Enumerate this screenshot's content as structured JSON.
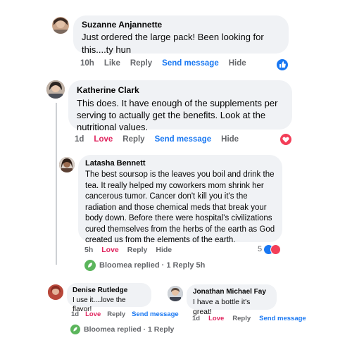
{
  "comments": [
    {
      "name": "Suzanne Anjannette",
      "text": "Just ordered the large pack! Been looking for this....ty hun",
      "time": "10h",
      "reaction": "Like",
      "reply": "Reply",
      "send": "Send message",
      "hide": "Hide"
    },
    {
      "name": "Katherine Clark",
      "text": "This does. It have enough of the supplements per serving to actually get the benefits. Look at the nutritional values.",
      "time": "1d",
      "reaction": "Love",
      "reply": "Reply",
      "send": "Send message",
      "hide": "Hide"
    },
    {
      "name": "Latasha Bennett",
      "text": "The best soursop is the leaves you boil and drink the tea. It really helped my coworkers mom shrink her cancerous tumor. Cancer don't kill you it's the radiation and those chemical meds that break your body down. Before there were hospital's civilizations cured themselves from the herbs of the earth as God created us from the elements of the earth.",
      "time": "5h",
      "reaction": "Love",
      "reply": "Reply",
      "hide": "Hide",
      "reaction_count": "5",
      "replies_text": "Bloomea replied · 1 Reply 5h"
    },
    {
      "name": "Denise Rutledge",
      "text": "I use it....love the flavor!",
      "time": "1d",
      "reaction": "Love",
      "reply": "Reply",
      "send": "Send message",
      "replies_text": "Bloomea replied · 1 Reply"
    },
    {
      "name": "Jonathan Michael Fay",
      "text": "I have a bottle it's great!",
      "time": "1d",
      "reaction": "Love",
      "reply": "Reply",
      "send": "Send message"
    }
  ],
  "colors": {
    "bubble": "#f0f2f5",
    "link": "#1877f2",
    "love": "#e0245e",
    "muted": "#65676b"
  }
}
